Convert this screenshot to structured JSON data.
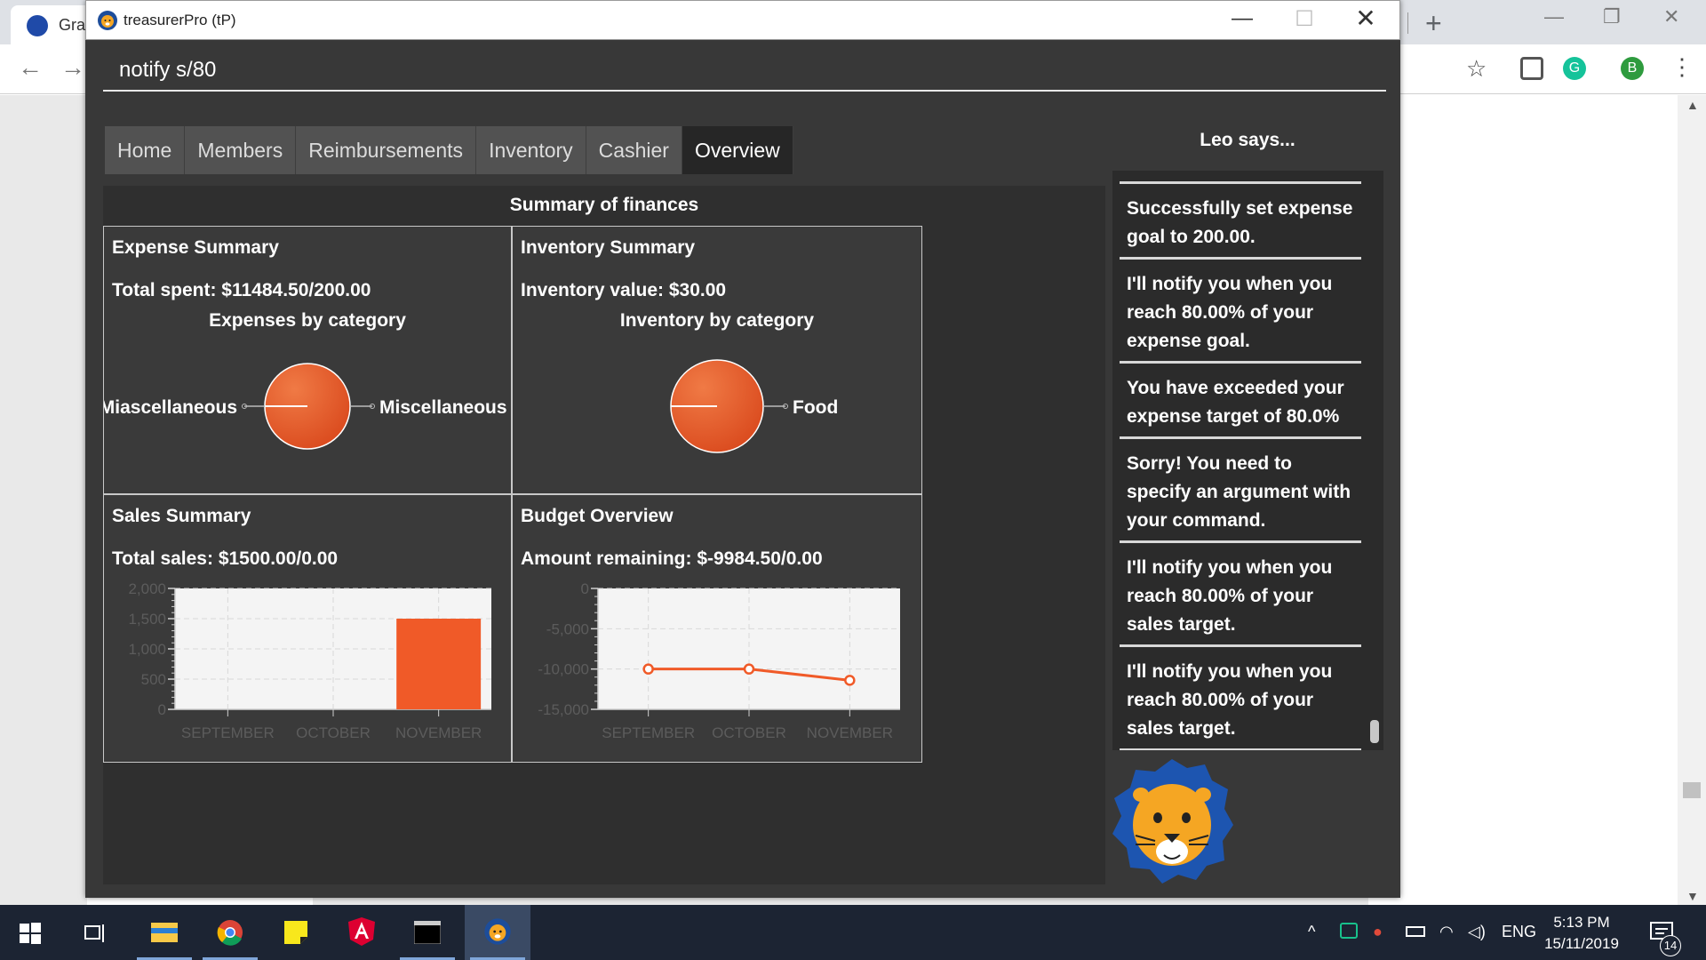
{
  "browser": {
    "tab_title": "Gra",
    "profile_initial": "B",
    "grammarly_initial": "G"
  },
  "window": {
    "title": "treasurerPro (tP)"
  },
  "command": {
    "value": "notify s/80"
  },
  "tabs": [
    {
      "label": "Home",
      "active": false
    },
    {
      "label": "Members",
      "active": false
    },
    {
      "label": "Reimbursements",
      "active": false
    },
    {
      "label": "Inventory",
      "active": false
    },
    {
      "label": "Cashier",
      "active": false
    },
    {
      "label": "Overview",
      "active": true
    }
  ],
  "summary": {
    "title": "Summary of finances",
    "expense": {
      "title": "Expense Summary",
      "stat": "Total spent: $11484.50/200.00",
      "chart_title": "Expenses by category",
      "label_left": "Miascellaneous",
      "label_right": "Miscellaneous"
    },
    "inventory": {
      "title": "Inventory Summary",
      "stat": "Inventory value: $30.00",
      "chart_title": "Inventory by category",
      "label_right": "Food"
    },
    "sales": {
      "title": "Sales Summary",
      "stat": "Total sales: $1500.00/0.00"
    },
    "budget": {
      "title": "Budget Overview",
      "stat": "Amount remaining: $-9984.50/0.00"
    }
  },
  "chart_data": [
    {
      "type": "pie",
      "title": "Expenses by category",
      "slices": [
        {
          "label": "Miascellaneous",
          "value": 0
        },
        {
          "label": "Miscellaneous",
          "value": 11484.5
        }
      ],
      "color": "#e85a2a"
    },
    {
      "type": "pie",
      "title": "Inventory by category",
      "slices": [
        {
          "label": "Food",
          "value": 30
        }
      ],
      "color": "#e85a2a"
    },
    {
      "type": "bar",
      "title": "",
      "categories": [
        "SEPTEMBER",
        "OCTOBER",
        "NOVEMBER"
      ],
      "values": [
        0,
        0,
        1500
      ],
      "ylim": [
        0,
        2000
      ],
      "yticks": [
        "0",
        "500",
        "1,000",
        "1,500",
        "2,000"
      ],
      "color": "#f05a28",
      "grid": true
    },
    {
      "type": "line",
      "title": "",
      "categories": [
        "SEPTEMBER",
        "OCTOBER",
        "NOVEMBER"
      ],
      "values": [
        -10000,
        -10000,
        -11400
      ],
      "ylim": [
        -15000,
        0
      ],
      "yticks": [
        "0",
        "-5,000",
        "-10,000",
        "-15,000"
      ],
      "color": "#f05a28",
      "grid": true
    }
  ],
  "leo": {
    "title": "Leo says...",
    "messages": [
      "Successfully set expense goal to 200.00.",
      "I'll notify you when you reach 80.00% of your expense goal.",
      "You have exceeded your expense target of 80.0%",
      "Sorry! You need to specify an argument with your command.",
      "I'll notify you when you reach 80.00% of your sales target.",
      "I'll notify you when you reach 80.00% of your sales target."
    ]
  },
  "taskbar": {
    "time": "5:13 PM",
    "date": "15/11/2019",
    "lang": "ENG",
    "notification_count": "14"
  }
}
